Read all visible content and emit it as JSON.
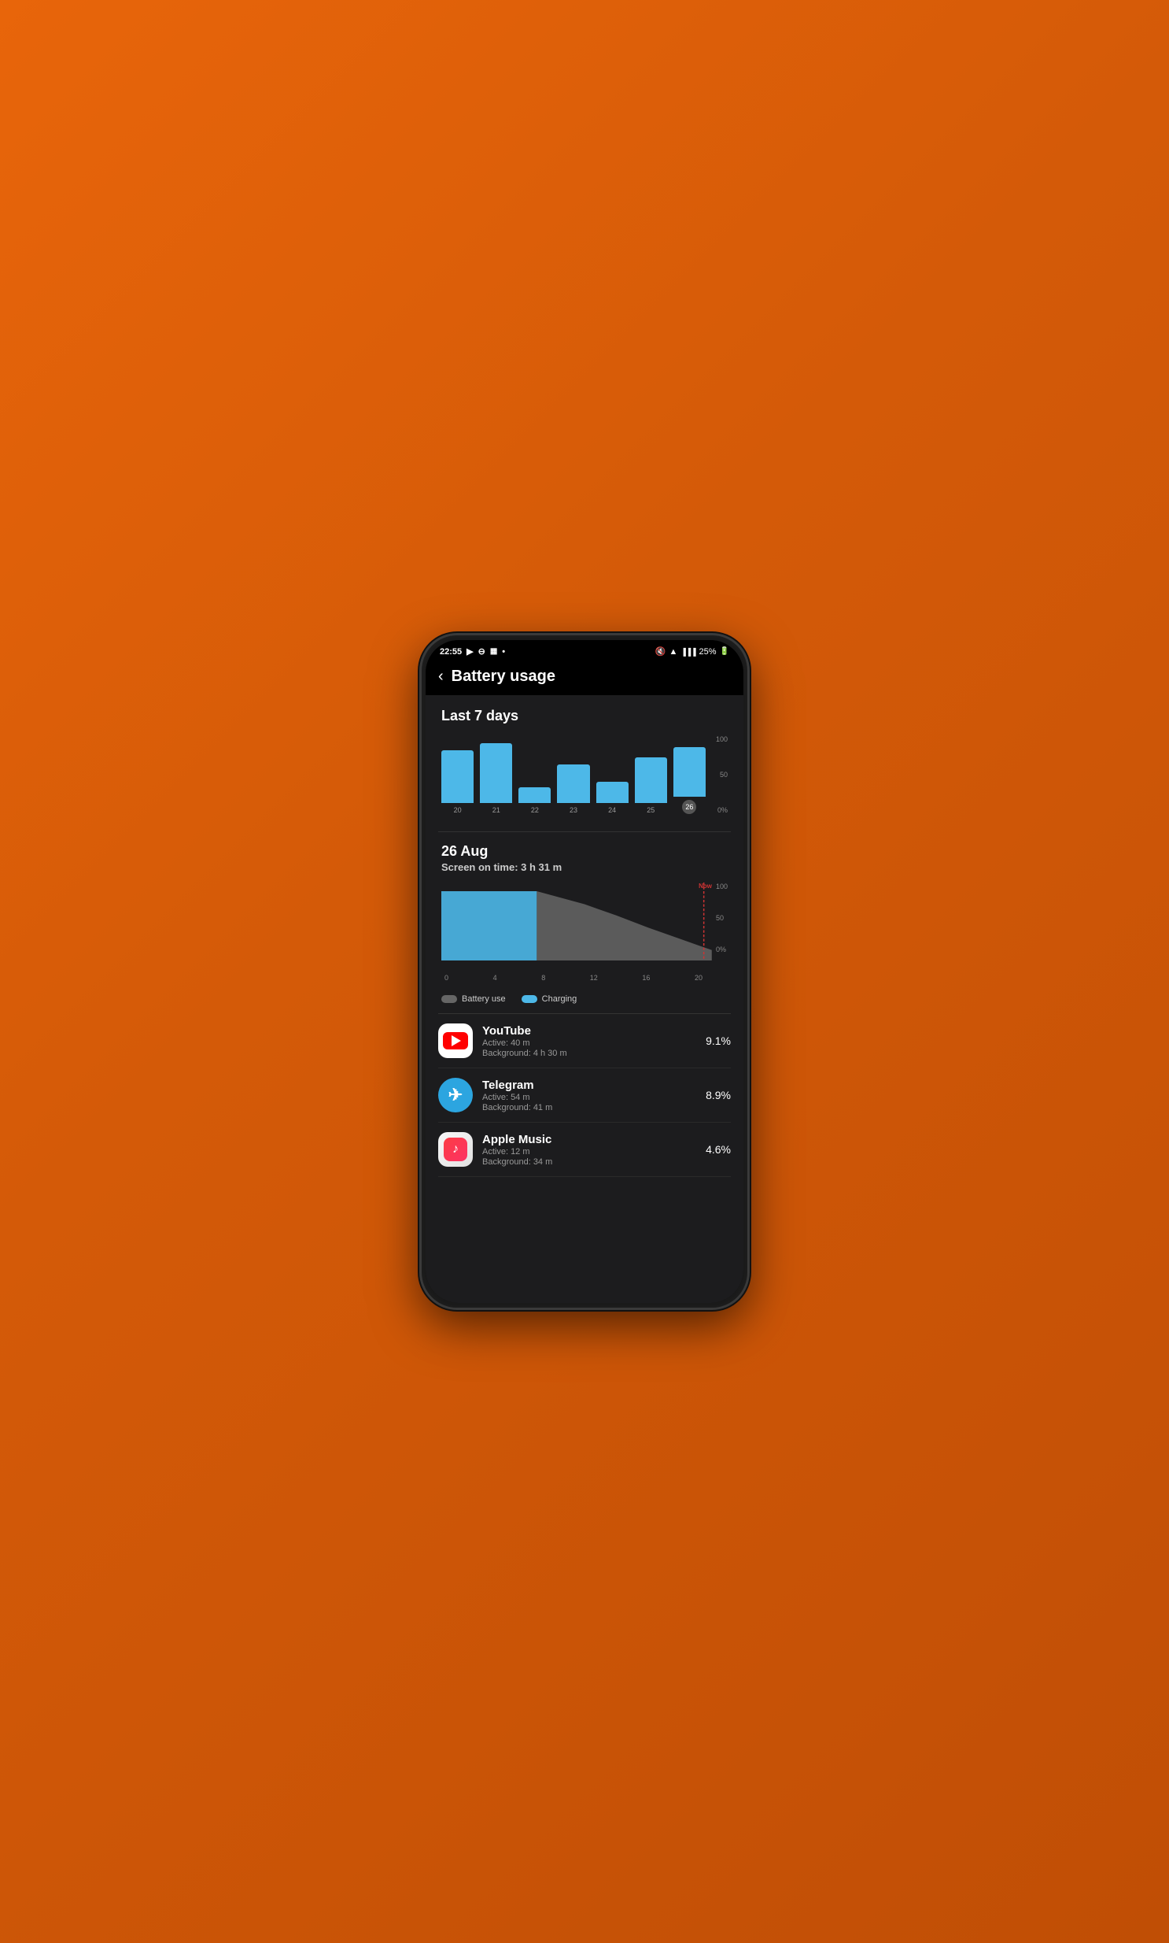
{
  "status_bar": {
    "time": "22:55",
    "battery_pct": "25%",
    "icons_left": [
      "▶",
      "⊖",
      "⊞",
      "•"
    ],
    "icons_right": [
      "🔇",
      "WiFi",
      "Signal"
    ]
  },
  "nav": {
    "back_label": "‹",
    "title": "Battery usage"
  },
  "chart7days": {
    "title": "Last 7 days",
    "days": [
      "20",
      "21",
      "22",
      "23",
      "24",
      "25",
      "26"
    ],
    "heights": [
      75,
      85,
      22,
      55,
      30,
      65,
      70
    ],
    "active_day": "26",
    "y_labels": [
      "100",
      "50",
      "0%"
    ]
  },
  "day_section": {
    "date": "26 Aug",
    "screen_time_label": "Screen on time: 3 h 31 m",
    "x_labels": [
      "0",
      "4",
      "8",
      "12",
      "16",
      "20"
    ],
    "y_labels": [
      "100",
      "50",
      "0%"
    ],
    "now_label": "Now"
  },
  "legend": {
    "items": [
      {
        "color": "gray",
        "label": "Battery use"
      },
      {
        "color": "blue",
        "label": "Charging"
      }
    ]
  },
  "apps": [
    {
      "name": "YouTube",
      "detail1": "Active: 40 m",
      "detail2": "Background: 4 h 30 m",
      "pct": "9.1%",
      "icon_type": "youtube"
    },
    {
      "name": "Telegram",
      "detail1": "Active: 54 m",
      "detail2": "Background: 41 m",
      "pct": "8.9%",
      "icon_type": "telegram"
    },
    {
      "name": "Apple Music",
      "detail1": "Active: 12 m",
      "detail2": "Background: 34 m",
      "pct": "4.6%",
      "icon_type": "apple-music"
    }
  ]
}
